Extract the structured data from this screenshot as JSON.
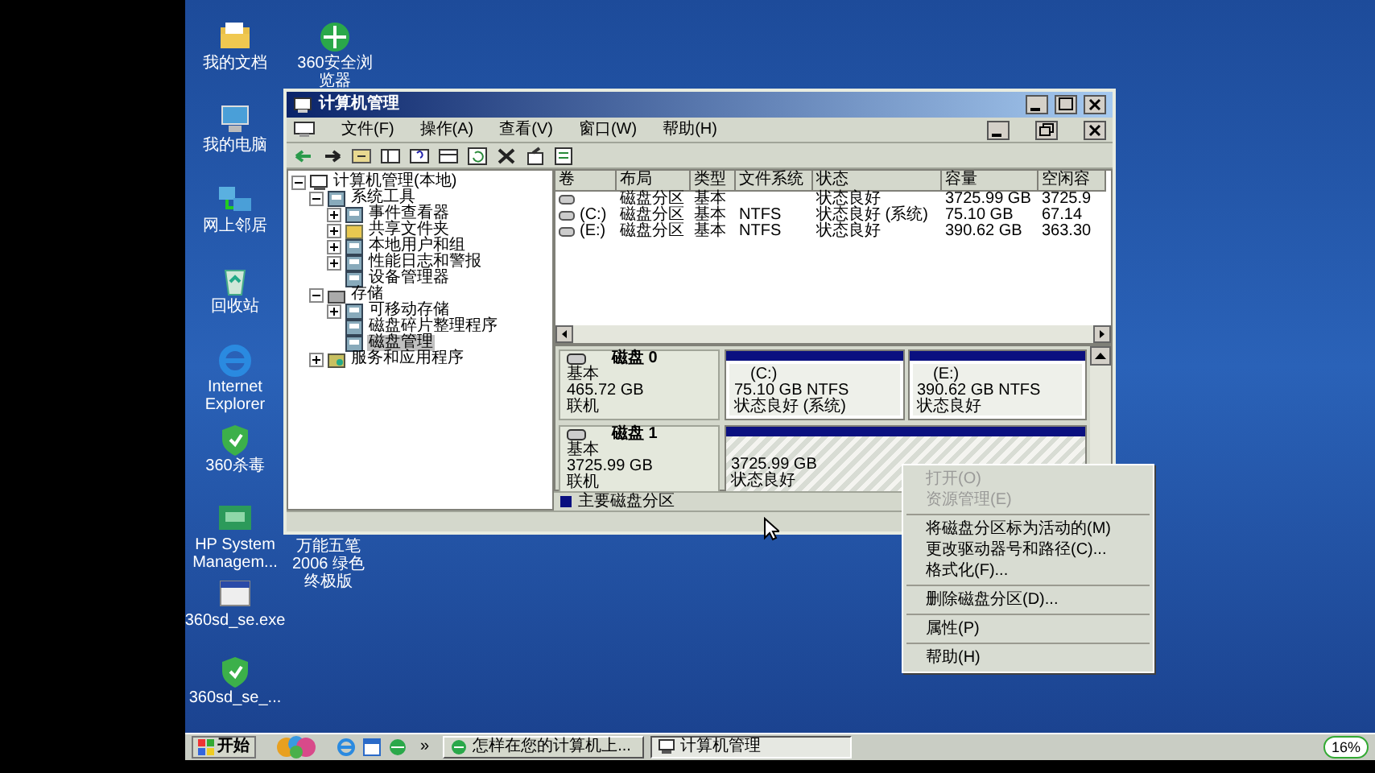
{
  "desktop_icons": [
    {
      "label": "我的文档",
      "kind": "documents"
    },
    {
      "label": "360安全浏览器",
      "kind": "browser360"
    },
    {
      "label": "我的电脑",
      "kind": "computer"
    },
    {
      "label": "网上邻居",
      "kind": "network"
    },
    {
      "label": "回收站",
      "kind": "recycle"
    },
    {
      "label": "Internet Explorer",
      "kind": "ie"
    },
    {
      "label": "360杀毒",
      "kind": "antivirus"
    },
    {
      "label": "HP System Managem...",
      "kind": "hp"
    },
    {
      "label": "万能五笔2006 绿色终极版",
      "kind": "text"
    },
    {
      "label": "360sd_se.exe",
      "kind": "exe"
    },
    {
      "label": "360sd_se_...",
      "kind": "antivirus"
    }
  ],
  "window": {
    "title": "计算机管理",
    "menu": [
      "文件(F)",
      "操作(A)",
      "查看(V)",
      "窗口(W)",
      "帮助(H)"
    ],
    "tree": [
      {
        "label": "计算机管理(本地)",
        "kind": "computer",
        "expanded": true,
        "selected": false,
        "children": [
          {
            "label": "系统工具",
            "kind": "tools",
            "expanded": true,
            "selected": false,
            "children": [
              {
                "label": "事件查看器",
                "kind": "viewer",
                "expanded": false,
                "selected": false
              },
              {
                "label": "共享文件夹",
                "kind": "folder",
                "expanded": false,
                "selected": false
              },
              {
                "label": "本地用户和组",
                "kind": "users",
                "expanded": false,
                "selected": false
              },
              {
                "label": "性能日志和警报",
                "kind": "perf",
                "expanded": false,
                "selected": false
              },
              {
                "label": "设备管理器",
                "kind": "device",
                "selected": false
              }
            ]
          },
          {
            "label": "存储",
            "kind": "storage",
            "expanded": true,
            "selected": false,
            "children": [
              {
                "label": "可移动存储",
                "kind": "removable",
                "expanded": false,
                "selected": false
              },
              {
                "label": "磁盘碎片整理程序",
                "kind": "defrag",
                "selected": false
              },
              {
                "label": "磁盘管理",
                "kind": "disk",
                "selected": true
              }
            ]
          },
          {
            "label": "服务和应用程序",
            "kind": "services",
            "expanded": false,
            "selected": false
          }
        ]
      }
    ],
    "volume_table": {
      "columns": [
        "卷",
        "布局",
        "类型",
        "文件系统",
        "状态",
        "容量",
        "空闲容"
      ],
      "rows": [
        [
          "",
          "磁盘分区",
          "基本",
          "",
          "状态良好",
          "3725.99 GB",
          "3725.9"
        ],
        [
          "(C:)",
          "磁盘分区",
          "基本",
          "NTFS",
          "状态良好 (系统)",
          "75.10 GB",
          "67.14"
        ],
        [
          "(E:)",
          "磁盘分区",
          "基本",
          "NTFS",
          "状态良好",
          "390.62 GB",
          "363.30"
        ]
      ]
    },
    "disks": [
      {
        "name": "磁盘 0",
        "type": "基本",
        "size": "465.72 GB",
        "status": "联机",
        "partitions": [
          {
            "letter": "(C:)",
            "detail": "75.10 GB NTFS",
            "status": "状态良好 (系统)",
            "selected": false
          },
          {
            "letter": "(E:)",
            "detail": "390.62 GB NTFS",
            "status": "状态良好",
            "selected": false
          }
        ]
      },
      {
        "name": "磁盘 1",
        "type": "基本",
        "size": "3725.99 GB",
        "status": "联机",
        "partitions": [
          {
            "detail": "3725.99 GB",
            "status": "状态良好",
            "selected": true
          }
        ]
      }
    ],
    "legend": "主要磁盘分区"
  },
  "context_menu": [
    {
      "kind": "item",
      "label": "打开(O)",
      "disabled": true
    },
    {
      "kind": "item",
      "label": "资源管理(E)",
      "disabled": true
    },
    {
      "kind": "separator"
    },
    {
      "kind": "item",
      "label": "将磁盘分区标为活动的(M)",
      "disabled": false
    },
    {
      "kind": "item",
      "label": "更改驱动器号和路径(C)...",
      "disabled": false
    },
    {
      "kind": "item",
      "label": "格式化(F)...",
      "disabled": false
    },
    {
      "kind": "separator"
    },
    {
      "kind": "item",
      "label": "删除磁盘分区(D)...",
      "disabled": false
    },
    {
      "kind": "separator"
    },
    {
      "kind": "item",
      "label": "属性(P)",
      "disabled": false
    },
    {
      "kind": "separator"
    },
    {
      "kind": "item",
      "label": "帮助(H)",
      "disabled": false
    }
  ],
  "taskbar": {
    "start": "开始",
    "more": "»",
    "tasks": [
      {
        "label": "怎样在您的计算机上...",
        "selected": false
      },
      {
        "label": "计算机管理",
        "selected": true
      }
    ],
    "tray_percent": "16%"
  }
}
